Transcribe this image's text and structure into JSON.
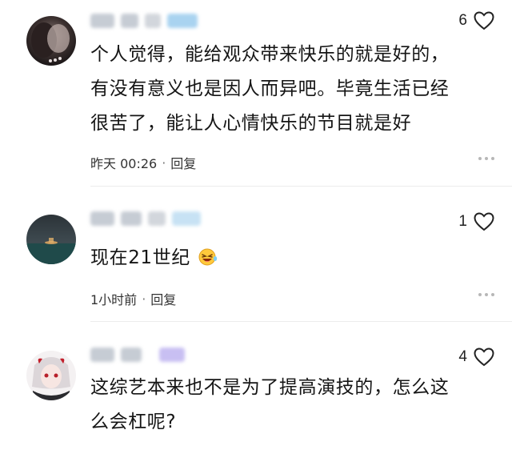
{
  "colors": {
    "blur_gray": "#c9cfd6",
    "blur_blue": "#a9d3f0",
    "blur_purple": "#c8bff2",
    "heart_stroke": "#222222",
    "meta_text": "#333333"
  },
  "comments": [
    {
      "likes": "6",
      "text_line1": "个人觉得，能给观众带来快乐的就是好的，",
      "text_line2": "有没有意义也是因人而异吧。毕竟生活已经",
      "text_line3": "很苦了，能让人心情快乐的节目就是好",
      "time": "昨天 00:26",
      "reply_label": "回复"
    },
    {
      "likes": "1",
      "text_line1": "现在21世纪",
      "emoji": "laughing-emoji-icon",
      "time": "1小时前",
      "reply_label": "回复"
    },
    {
      "likes": "4",
      "text_line1": "这综艺本来也不是为了提高演技的，怎么这",
      "text_line2": "么会杠呢?"
    }
  ],
  "separator": "·"
}
